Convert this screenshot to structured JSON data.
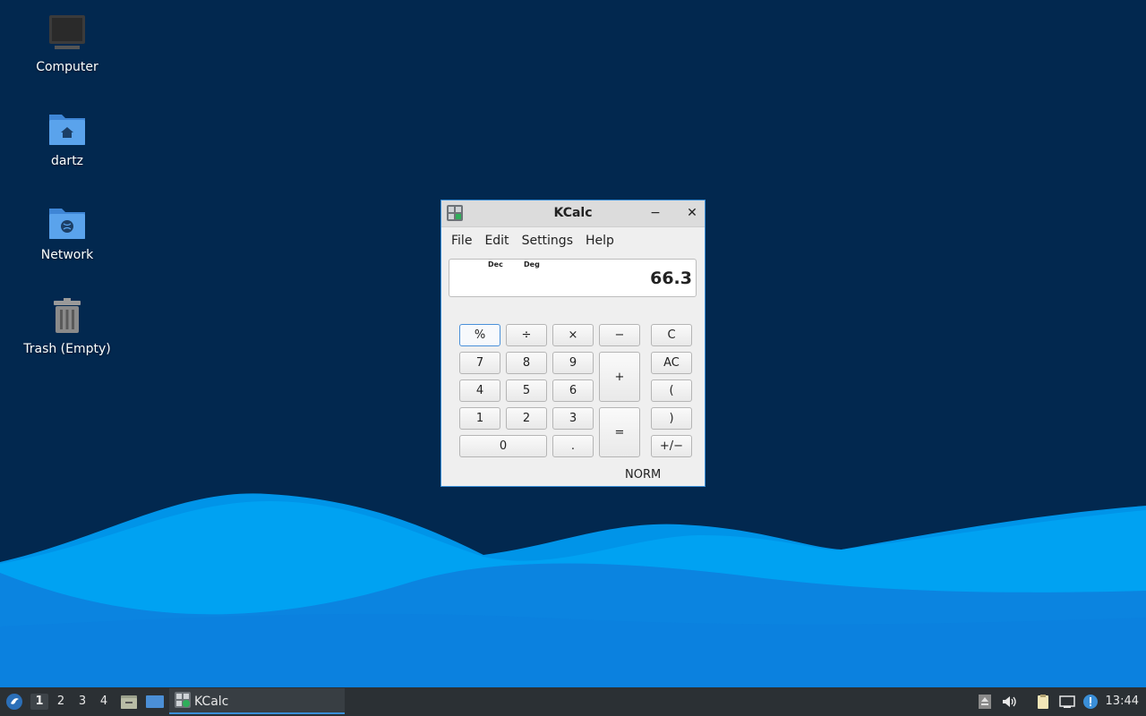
{
  "desktop": {
    "icons": [
      {
        "label": "Computer",
        "icon": "computer-icon"
      },
      {
        "label": "dartz",
        "icon": "home-folder-icon"
      },
      {
        "label": "Network",
        "icon": "network-folder-icon"
      },
      {
        "label": "Trash (Empty)",
        "icon": "trash-icon"
      }
    ]
  },
  "window": {
    "title": "KCalc",
    "minimize_symbol": "−",
    "close_symbol": "✕",
    "menu": [
      "File",
      "Edit",
      "Settings",
      "Help"
    ],
    "display": {
      "base_mode": "Dec",
      "angle_mode": "Deg",
      "value": "66.3"
    },
    "keys": {
      "percent": "%",
      "divide": "÷",
      "multiply": "×",
      "subtract": "−",
      "clear": "C",
      "seven": "7",
      "eight": "8",
      "nine": "9",
      "add": "+",
      "all_clear": "AC",
      "four": "4",
      "five": "5",
      "six": "6",
      "open_paren": "(",
      "one": "1",
      "two": "2",
      "three": "3",
      "equals": "=",
      "close_paren": ")",
      "zero": "0",
      "decimal": ".",
      "sign": "+/−"
    },
    "status": "NORM"
  },
  "taskbar": {
    "workspaces": [
      "1",
      "2",
      "3",
      "4"
    ],
    "active_workspace": "1",
    "task_label": "KCalc",
    "clock": "13:44"
  },
  "colors": {
    "desktop_bg": "#02284f",
    "wave_light": "#00a0f0",
    "wave_dark": "#0a78d8",
    "window_border": "#3a8fd8",
    "taskbar_bg": "#2b3034"
  }
}
